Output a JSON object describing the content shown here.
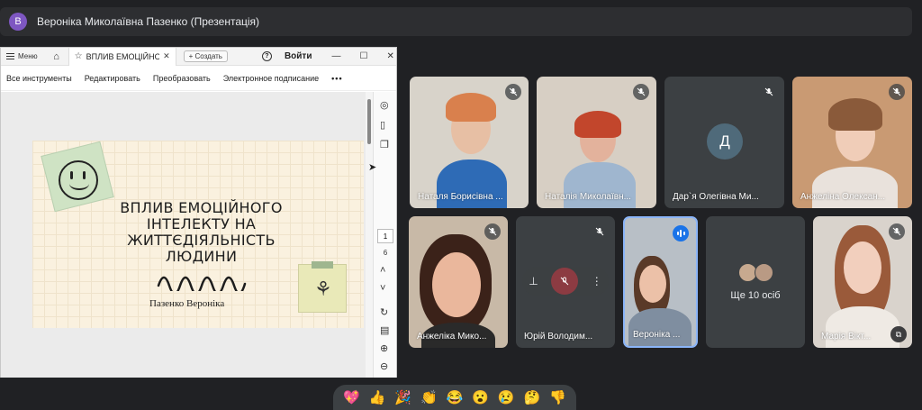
{
  "presenter_bar": {
    "avatar_letter": "В",
    "title": "Вероніка Миколаївна Пазенко (Презентація)"
  },
  "pdf_window": {
    "menu_label": "Меню",
    "tab_title": "ВПЛИВ ЕМОЦІЙНО...",
    "create_label": "Создать",
    "signin_label": "Войти",
    "toolbar": [
      "Все инструменты",
      "Редактировать",
      "Преобразовать",
      "Электронное подписание"
    ],
    "page_current": "1",
    "page_total": "6"
  },
  "slide": {
    "title": "ВПЛИВ ЕМОЦІЙНОГО ІНТЕЛЕКТУ НА ЖИТТЄДІЯЛЬНІСТЬ ЛЮДИНИ",
    "author": "Пазенко Вероніка"
  },
  "participants": [
    {
      "name": "Наталя Борисівна ...",
      "muted": true
    },
    {
      "name": "Наталія Миколаївн...",
      "muted": true
    },
    {
      "name": "Дар`я Олегівна Ми...",
      "muted": true,
      "avatar_letter": "Д"
    },
    {
      "name": "Анжеліна Олексан...",
      "muted": true
    },
    {
      "name": "Анжеліка Мико...",
      "muted": true
    },
    {
      "name": "Юрій Володим...",
      "muted": true
    },
    {
      "name": "Вероніка ...",
      "speaking": true
    },
    {
      "more_label": "Ще 10 осіб"
    },
    {
      "name": "Марія Вікт...",
      "muted": true
    }
  ],
  "reactions": [
    "💖",
    "👍",
    "🎉",
    "👏",
    "😂",
    "😮",
    "😢",
    "🤔",
    "👎"
  ],
  "colors": {
    "background": "#202124",
    "tile": "#3c4043",
    "speaking_accent": "#1a73e8",
    "presenter_avatar": "#7e57c2"
  }
}
